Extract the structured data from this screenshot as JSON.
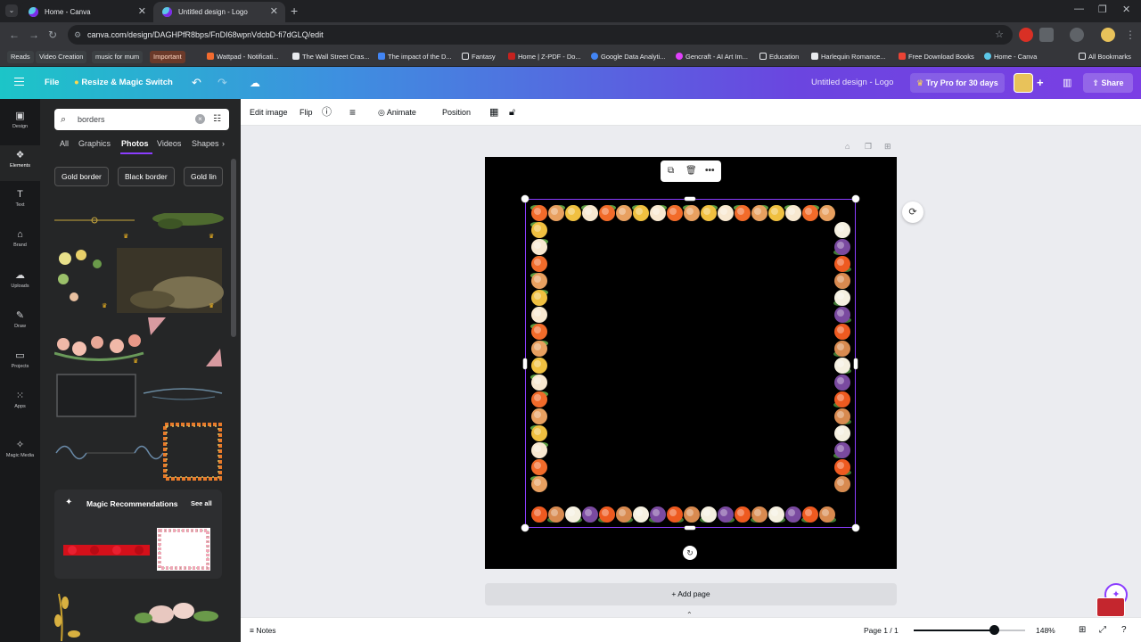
{
  "browser": {
    "tabs": [
      {
        "title": "Home - Canva",
        "active": false
      },
      {
        "title": "Untitled design - Logo",
        "active": true
      }
    ],
    "url": "canva.com/design/DAGHPfR8bps/FnDI68wpnVdcbD-fi7dGLQ/edit",
    "bookmarks": [
      "Reads",
      "Video Creation",
      "music for mum",
      "Important",
      "Wattpad - Notificati...",
      "The Wall Street Cras...",
      "The impact of the D...",
      "Fantasy",
      "Home | Z-PDF - Do...",
      "Google Data Analyti...",
      "Gencraft - AI Art Im...",
      "Education",
      "Harlequin Romance...",
      "Free Download Books",
      "Home - Canva",
      "All Bookmarks"
    ]
  },
  "header": {
    "file": "File",
    "resize": "Resize & Magic Switch",
    "doc_title": "Untitled design - Logo",
    "try_pro": "Try Pro for 30 days",
    "share": "Share"
  },
  "rail": [
    "Design",
    "Elements",
    "Text",
    "Brand",
    "Uploads",
    "Draw",
    "Projects",
    "Apps",
    "Magic Media"
  ],
  "panel": {
    "search_value": "borders",
    "tabs": [
      "All",
      "Graphics",
      "Photos",
      "Videos",
      "Shapes"
    ],
    "chips": [
      "Gold border",
      "Black border",
      "Gold lin"
    ],
    "magic_title": "Magic Recommendations",
    "magic_see_all": "See all"
  },
  "toolbar": {
    "edit_image": "Edit image",
    "flip": "Flip",
    "animate": "Animate",
    "position": "Position"
  },
  "canvas": {
    "add_page": "+ Add page"
  },
  "footer": {
    "notes": "Notes",
    "page": "Page 1 / 1",
    "zoom": "148%",
    "zoom_level": 0.72
  },
  "colors": {
    "accent": "#8b3dff",
    "rail_bg": "#18191b",
    "panel_bg": "#252627"
  }
}
